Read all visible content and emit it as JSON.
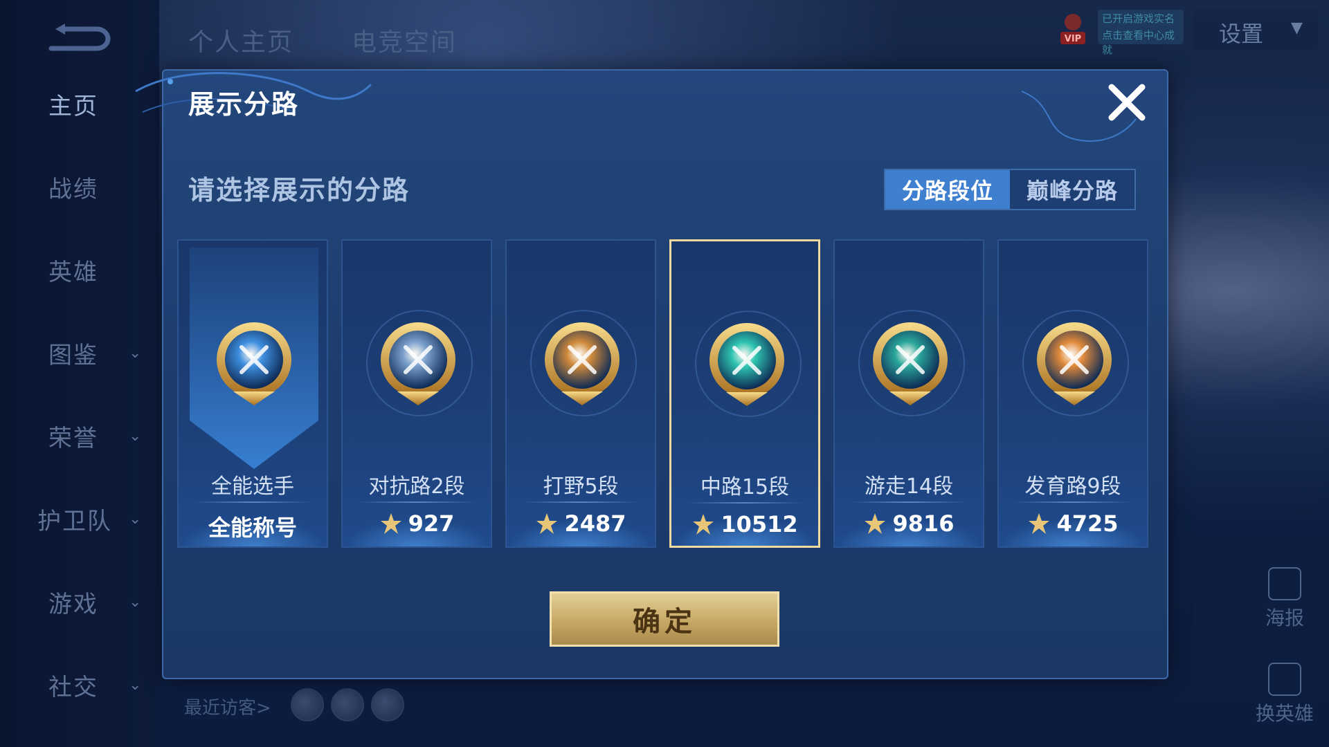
{
  "sidebar": {
    "items": [
      {
        "label": "主页",
        "has_chevron": false,
        "active": true
      },
      {
        "label": "战绩",
        "has_chevron": false,
        "active": false
      },
      {
        "label": "英雄",
        "has_chevron": false,
        "active": false
      },
      {
        "label": "图鉴",
        "has_chevron": true,
        "active": false
      },
      {
        "label": "荣誉",
        "has_chevron": true,
        "active": false
      },
      {
        "label": "护卫队",
        "has_chevron": true,
        "active": false
      },
      {
        "label": "游戏",
        "has_chevron": true,
        "active": false
      },
      {
        "label": "社交",
        "has_chevron": true,
        "active": false
      }
    ]
  },
  "topbar": {
    "tabs": [
      "个人主页",
      "电竞空间"
    ],
    "settings_label": "设置",
    "vip_label": "VIP",
    "vip_note_line1": "已开启游戏实名",
    "vip_note_line2": "点击查看中心成就"
  },
  "bottom": {
    "recent_visitors": "最近访客>",
    "poster_label": "海报",
    "switch_hero_label": "换英雄"
  },
  "dialog": {
    "title": "展示分路",
    "prompt": "请选择展示的分路",
    "tabs": [
      {
        "label": "分路段位",
        "active": true
      },
      {
        "label": "巅峰分路",
        "active": false
      }
    ],
    "confirm_label": "确定"
  },
  "lanes": [
    {
      "name": "全能选手",
      "value": "全能称号",
      "emblem": "all-round-emblem-icon",
      "color": "#3f8fe0",
      "selected": false,
      "show_star": false
    },
    {
      "name": "对抗路2段",
      "value": "927",
      "emblem": "clash-lane-emblem-icon",
      "color": "#7aa0cc",
      "selected": false,
      "show_star": true
    },
    {
      "name": "打野5段",
      "value": "2487",
      "emblem": "jungle-emblem-icon",
      "color": "#d08a3a",
      "selected": false,
      "show_star": true
    },
    {
      "name": "中路15段",
      "value": "10512",
      "emblem": "mid-lane-emblem-icon",
      "color": "#2fc4b0",
      "selected": true,
      "show_star": true
    },
    {
      "name": "游走14段",
      "value": "9816",
      "emblem": "roam-emblem-icon",
      "color": "#2aa79a",
      "selected": false,
      "show_star": true
    },
    {
      "name": "发育路9段",
      "value": "4725",
      "emblem": "farm-lane-emblem-icon",
      "color": "#e08a3a",
      "selected": false,
      "show_star": true
    }
  ]
}
